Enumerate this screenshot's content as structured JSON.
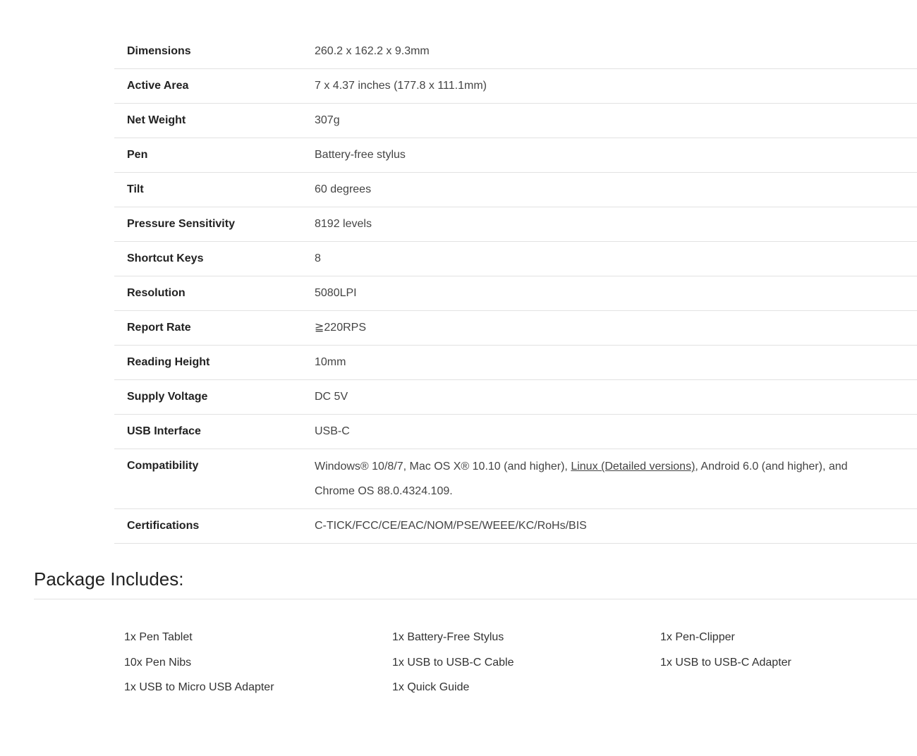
{
  "specs": [
    {
      "label": "Dimensions",
      "value": "260.2 x 162.2 x 9.3mm"
    },
    {
      "label": "Active Area",
      "value": "7 x 4.37 inches (177.8 x 111.1mm)"
    },
    {
      "label": "Net Weight",
      "value": "307g"
    },
    {
      "label": "Pen",
      "value": "Battery-free stylus"
    },
    {
      "label": "Tilt",
      "value": "60 degrees"
    },
    {
      "label": "Pressure Sensitivity",
      "value": "8192 levels"
    },
    {
      "label": "Shortcut Keys",
      "value": "8"
    },
    {
      "label": "Resolution",
      "value": "5080LPI"
    },
    {
      "label": "Report Rate",
      "value": "≧220RPS"
    },
    {
      "label": "Reading Height",
      "value": "10mm"
    },
    {
      "label": "Supply Voltage",
      "value": "DC 5V"
    },
    {
      "label": "USB Interface",
      "value": "USB-C"
    }
  ],
  "compatibility": {
    "label": "Compatibility",
    "value_before": "Windows® 10/8/7, Mac OS X® 10.10 (and higher), ",
    "link_text": "Linux (Detailed versions)",
    "value_after": ", Android 6.0 (and higher), and Chrome OS 88.0.4324.109."
  },
  "certifications": {
    "label": "Certifications",
    "value": "C-TICK/FCC/CE/EAC/NOM/PSE/WEEE/KC/RoHs/BIS"
  },
  "package": {
    "title": "Package Includes:",
    "items": [
      "1x Pen Tablet",
      "1x Battery-Free Stylus",
      "1x Pen-Clipper",
      "10x Pen Nibs",
      "1x USB to USB-C Cable",
      "1x USB to USB-C Adapter",
      "1x USB to Micro USB Adapter",
      "1x Quick Guide"
    ]
  }
}
